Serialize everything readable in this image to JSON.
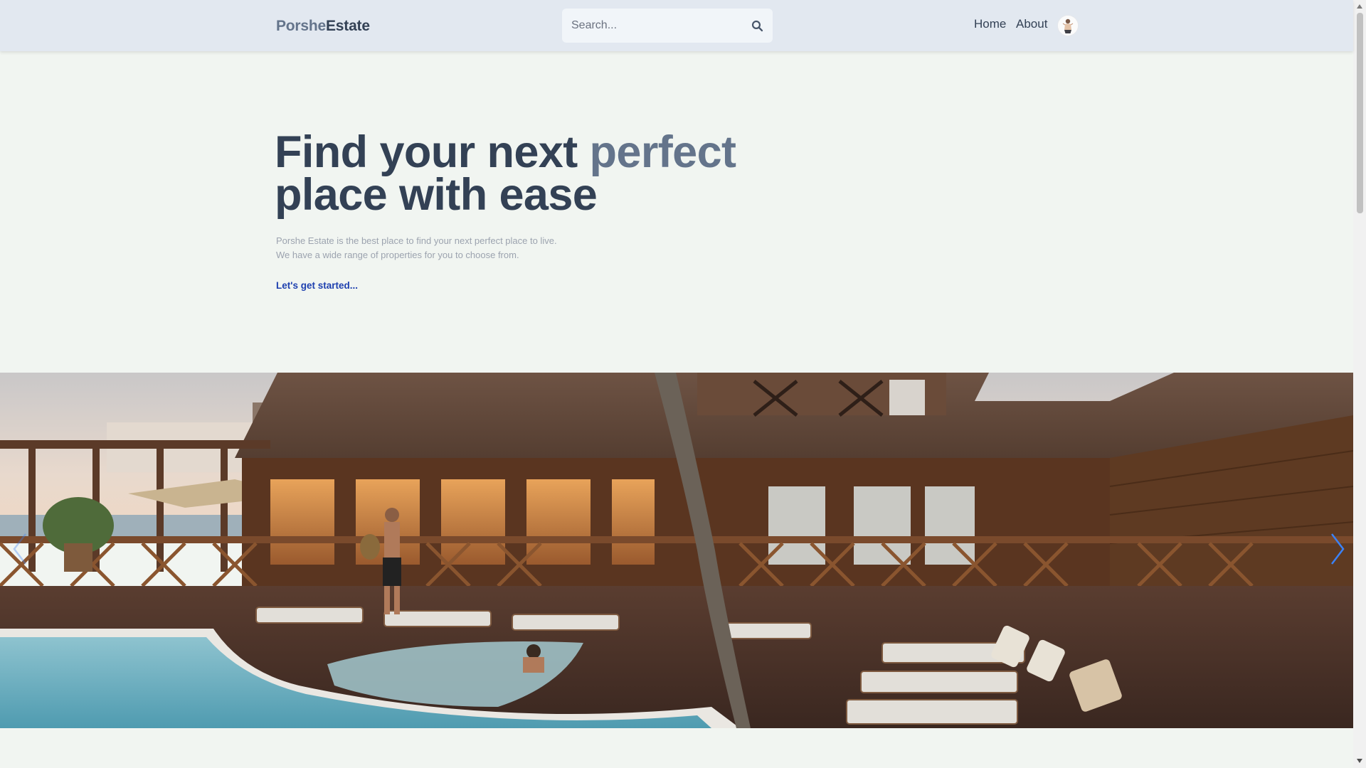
{
  "header": {
    "logo_part1": "Porshe",
    "logo_part2": "Estate",
    "search_placeholder": "Search...",
    "nav": {
      "home": "Home",
      "about": "About"
    }
  },
  "hero": {
    "title_line1_start": "Find your next ",
    "title_line1_accent": "perfect",
    "title_line2": "place with ease",
    "desc_line1": "Porshe Estate is the best place to find your next perfect place to live.",
    "desc_line2": "We have a wide range of properties for you to choose from.",
    "cta": "Let's get started..."
  },
  "icons": {
    "search": "search-icon",
    "prev": "chevron-left-icon",
    "next": "chevron-right-icon",
    "avatar": "avatar"
  },
  "colors": {
    "header_bg": "#e2e8f0",
    "page_bg": "#f1f5f1",
    "logo_light": "#64748b",
    "logo_dark": "#334155",
    "heading": "#334155",
    "accent": "#64748b",
    "link": "#1e40af",
    "slider_arrow": "#3b82f6"
  }
}
